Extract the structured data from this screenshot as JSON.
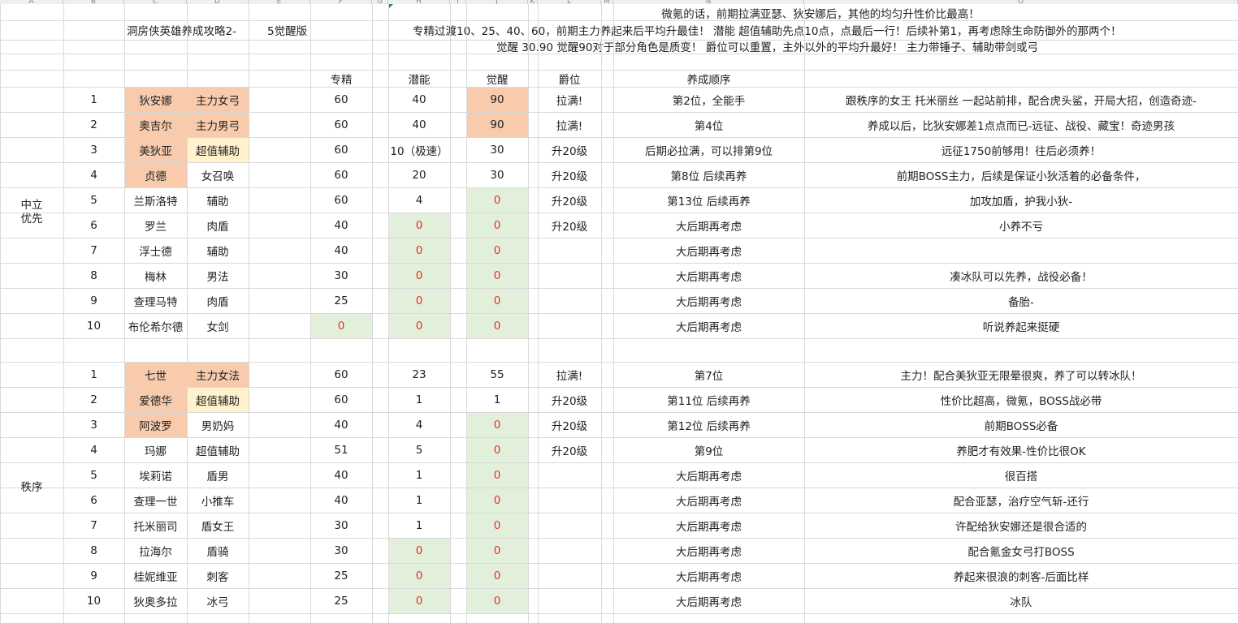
{
  "sheet": {
    "col_letters": [
      "A",
      "B",
      "C",
      "D",
      "E",
      "F",
      "G",
      "H",
      "I",
      "J",
      "K",
      "L",
      "M",
      "N",
      "O"
    ],
    "title": "洞房侠英雄养成攻略2-",
    "subtitle": "5觉醒版",
    "notes": [
      "微氪的话，前期拉满亚瑟、狄安娜后，其他的均匀升性价比最高！",
      "专精过渡10、25、40、60，前期主力养起来后平均升最佳！        潜能 超值辅助先点10点，点最后一行！后续补第1，再考虑除生命防御外的那两个！",
      "觉醒 30.90    觉醒90对于部分角色是质变！        爵位可以重置，主外以外的平均升最好！        主力带锤子、辅助带剑或弓"
    ],
    "headers": {
      "zhuanjing": "专精",
      "qianneng": "潜能",
      "juexing": "觉醒",
      "jueWei": "爵位",
      "order": "养成顺序"
    },
    "colors": {
      "orange": "#f8cbad",
      "yellow": "#fff2cc",
      "green": "#e2efda",
      "grid": "#d9d9d9",
      "zero_red": "#e2322c"
    },
    "groups": [
      {
        "name": "中立\n优先",
        "rows": [
          {
            "no": "1",
            "name": "狄安娜",
            "role": "主力女弓",
            "zj": "60",
            "qn": "40",
            "jx": "90",
            "jw": "拉满!",
            "order": "第2位，全能手",
            "note": "跟秩序的女王 托米丽丝 一起站前排，配合虎头鲨，开局大招，创造奇迹-",
            "hl": {
              "name": "orange",
              "role": "orange",
              "jx": "orange"
            }
          },
          {
            "no": "2",
            "name": "奥吉尔",
            "role": "主力男弓",
            "zj": "60",
            "qn": "40",
            "jx": "90",
            "jw": "拉满!",
            "order": "第4位",
            "note": "养成以后，比狄安娜差1点点而已-远征、战役、藏宝！奇迹男孩",
            "hl": {
              "name": "orange",
              "role": "orange",
              "jx": "orange"
            }
          },
          {
            "no": "3",
            "name": "美狄亚",
            "role": "超值辅助",
            "zj": "60",
            "qn": "10（极速）",
            "jx": "30",
            "jw": "升20级",
            "order": "后期必拉满，可以排第9位",
            "note": "远征1750前够用！往后必须养！",
            "hl": {
              "name": "orange",
              "role": "yellow"
            }
          },
          {
            "no": "4",
            "name": "贞德",
            "role": "女召唤",
            "zj": "60",
            "qn": "20",
            "jx": "30",
            "jw": "升20级",
            "order": "第8位 后续再养",
            "note": "前期BOSS主力，后续是保证小狄活着的必备条件，",
            "hl": {
              "name": "orange"
            }
          },
          {
            "no": "5",
            "name": "兰斯洛特",
            "role": "辅助",
            "zj": "60",
            "qn": "4",
            "jx": "0",
            "jw": "升20级",
            "order": "第13位 后续再养",
            "note": "加攻加盾，护我小狄-",
            "hl": {
              "jx": "green"
            }
          },
          {
            "no": "6",
            "name": "罗兰",
            "role": "肉盾",
            "zj": "40",
            "qn": "0",
            "jx": "0",
            "jw": "升20级",
            "order": "大后期再考虑",
            "note": "小养不亏",
            "hl": {
              "qn": "green",
              "jx": "green"
            }
          },
          {
            "no": "7",
            "name": "浮士德",
            "role": "辅助",
            "zj": "40",
            "qn": "0",
            "jx": "0",
            "jw": "",
            "order": "大后期再考虑",
            "note": "",
            "hl": {
              "qn": "green",
              "jx": "green"
            }
          },
          {
            "no": "8",
            "name": "梅林",
            "role": "男法",
            "zj": "30",
            "qn": "0",
            "jx": "0",
            "jw": "",
            "order": "大后期再考虑",
            "note": "凑冰队可以先养，战役必备！",
            "hl": {
              "qn": "green",
              "jx": "green"
            }
          },
          {
            "no": "9",
            "name": "查理马特",
            "role": "肉盾",
            "zj": "25",
            "qn": "0",
            "jx": "0",
            "jw": "",
            "order": "大后期再考虑",
            "note": "备胎-",
            "hl": {
              "qn": "green",
              "jx": "green"
            }
          },
          {
            "no": "10",
            "name": "布伦希尔德",
            "role": "女剑",
            "zj": "0",
            "qn": "0",
            "jx": "0",
            "jw": "",
            "order": "大后期再考虑",
            "note": "听说养起来挺硬",
            "hl": {
              "zj": "green",
              "qn": "green",
              "jx": "green"
            }
          }
        ]
      },
      {
        "name": "秩序",
        "rows": [
          {
            "no": "1",
            "name": "七世",
            "role": "主力女法",
            "zj": "60",
            "qn": "23",
            "jx": "55",
            "jw": "拉满!",
            "order": "第7位",
            "note": "主力！配合美狄亚无限晕很爽，养了可以转冰队！",
            "hl": {
              "name": "orange",
              "role": "orange"
            }
          },
          {
            "no": "2",
            "name": "爱德华",
            "role": "超值辅助",
            "zj": "60",
            "qn": "1",
            "jx": "1",
            "jw": "升20级",
            "order": "第11位 后续再养",
            "note": "性价比超高，微氪，BOSS战必带",
            "hl": {
              "name": "orange",
              "role": "yellow"
            }
          },
          {
            "no": "3",
            "name": "阿波罗",
            "role": "男奶妈",
            "zj": "40",
            "qn": "4",
            "jx": "0",
            "jw": "升20级",
            "order": "第12位 后续再养",
            "note": "前期BOSS必备",
            "hl": {
              "name": "orange",
              "jx": "green"
            }
          },
          {
            "no": "4",
            "name": "玛娜",
            "role": "超值辅助",
            "zj": "51",
            "qn": "5",
            "jx": "0",
            "jw": "升20级",
            "order": "第9位",
            "note": "养肥才有效果-性价比很OK",
            "hl": {
              "jx": "green"
            }
          },
          {
            "no": "5",
            "name": "埃莉诺",
            "role": "盾男",
            "zj": "40",
            "qn": "1",
            "jx": "0",
            "jw": "",
            "order": "大后期再考虑",
            "note": "很百搭",
            "hl": {
              "jx": "green"
            }
          },
          {
            "no": "6",
            "name": "查理一世",
            "role": "小推车",
            "zj": "40",
            "qn": "1",
            "jx": "0",
            "jw": "",
            "order": "大后期再考虑",
            "note": "配合亚瑟，治疗空气斩-还行",
            "hl": {
              "jx": "green"
            }
          },
          {
            "no": "7",
            "name": "托米丽司",
            "role": "盾女王",
            "zj": "30",
            "qn": "1",
            "jx": "0",
            "jw": "",
            "order": "大后期再考虑",
            "note": "许配给狄安娜还是很合适的",
            "hl": {
              "jx": "green"
            }
          },
          {
            "no": "8",
            "name": "拉海尔",
            "role": "盾骑",
            "zj": "30",
            "qn": "0",
            "jx": "0",
            "jw": "",
            "order": "大后期再考虑",
            "note": "配合氪金女弓打BOSS",
            "hl": {
              "qn": "green",
              "jx": "green"
            }
          },
          {
            "no": "9",
            "name": "桂妮维亚",
            "role": "刺客",
            "zj": "25",
            "qn": "0",
            "jx": "0",
            "jw": "",
            "order": "大后期再考虑",
            "note": "养起来很浪的刺客-后面比样",
            "hl": {
              "qn": "green",
              "jx": "green"
            }
          },
          {
            "no": "10",
            "name": "狄奥多拉",
            "role": "冰弓",
            "zj": "25",
            "qn": "0",
            "jx": "0",
            "jw": "",
            "order": "大后期再考虑",
            "note": "冰队",
            "hl": {
              "qn": "green",
              "jx": "green"
            }
          }
        ]
      }
    ]
  }
}
